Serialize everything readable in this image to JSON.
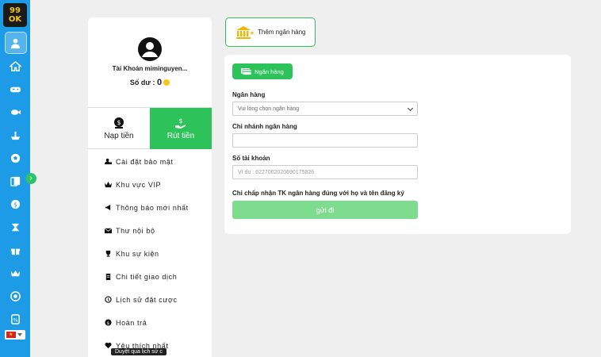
{
  "brand": {
    "logo_text": "99OK",
    "accent": "#2ec25a",
    "rail_color": "#1e9be6"
  },
  "rail": {
    "icons": [
      "user-icon",
      "home-icon",
      "gamepad-icon",
      "fish-icon",
      "boat-icon",
      "soccer-icon",
      "cards-icon",
      "coin-icon",
      "lottery-icon",
      "gift-icon",
      "vip-icon",
      "support-icon",
      "promo-icon"
    ],
    "active_index": 0,
    "language": "vietnam-flag-icon"
  },
  "account": {
    "name": "Tài Khoản miminguyen...",
    "balance_label": "Số dư :",
    "balance_value": "0",
    "tabs": [
      {
        "label": "Nạp tiền",
        "icon": "deposit-icon",
        "active": false
      },
      {
        "label": "Rút tiền",
        "icon": "withdraw-icon",
        "active": true
      }
    ],
    "menu": [
      {
        "label": "Cài đặt bảo mật",
        "icon": "user-lock-icon"
      },
      {
        "label": "Khu vực VIP",
        "icon": "crown-icon"
      },
      {
        "label": "Thông báo mới nhất",
        "icon": "megaphone-icon"
      },
      {
        "label": "Thư nội bộ",
        "icon": "envelope-icon"
      },
      {
        "label": "Khu sự kiện",
        "icon": "trophy-icon"
      },
      {
        "label": "Chi tiết giao dịch",
        "icon": "clipboard-icon"
      },
      {
        "label": "Lịch sử đặt cược",
        "icon": "history-icon"
      },
      {
        "label": "Hoàn trả",
        "icon": "refund-icon"
      },
      {
        "label": "Yêu thích nhất",
        "icon": "heart-icon"
      }
    ],
    "tooltip": "Duyệt qua lịch sử c"
  },
  "add_bank": {
    "label": "Thêm ngân hàng"
  },
  "form": {
    "chip_label": "Ngân hàng",
    "bank_label": "Ngân hàng",
    "bank_select_value": "Vui lòng chọn ngân hàng",
    "branch_label": "Chi nhánh ngân hàng",
    "branch_value": "",
    "account_label": "Số tài khoản",
    "account_placeholder": "Ví dụ : 6227002020690175826",
    "note": "Chỉ chấp nhận TK ngân hàng đúng với họ và tên đăng ký",
    "submit_label": "gửi đi"
  }
}
